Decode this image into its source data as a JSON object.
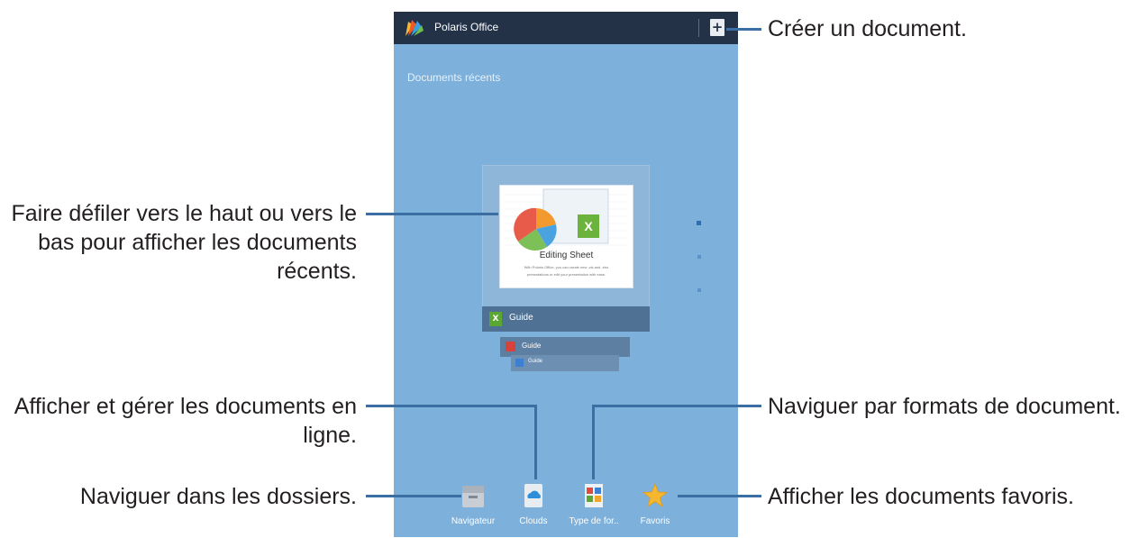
{
  "app": {
    "title": "Polaris Office",
    "section_title": "Documents récents",
    "new_document_icon": "plus-icon"
  },
  "thumbnail": {
    "heading": "Editing Sheet",
    "brand": "Polaris Office",
    "caption_line1": "With Polaris Office, you can create new .xls and .xlsx",
    "caption_line2": "presentations or edit your presentation with ease."
  },
  "recent_documents": [
    {
      "name": "Guide",
      "type": "xlsx",
      "color": "#5aa832"
    },
    {
      "name": "Guide",
      "type": "pptx",
      "color": "#d9423a"
    },
    {
      "name": "Guide",
      "type": "docx",
      "color": "#3d7fd1"
    }
  ],
  "bottom_nav": [
    {
      "label": "Navigateur",
      "icon": "folder-icon"
    },
    {
      "label": "Clouds",
      "icon": "cloud-icon"
    },
    {
      "label": "Type de for..",
      "icon": "file-types-icon"
    },
    {
      "label": "Favoris",
      "icon": "star-icon"
    }
  ],
  "callouts": {
    "create": "Créer un document.",
    "scroll_line1": "Faire défiler vers le haut ou vers le",
    "scroll_line2": "bas pour afficher les documents",
    "scroll_line3": "récents.",
    "online_line1": "Afficher et gérer les documents en",
    "online_line2": "ligne.",
    "formats": "Naviguer par formats de document.",
    "folders": "Naviguer dans les dossiers.",
    "favorites": "Afficher les documents favoris."
  },
  "colors": {
    "callout_line": "#3b6fa3",
    "screen_bg": "#7db0da",
    "action_bar": "#243248"
  }
}
